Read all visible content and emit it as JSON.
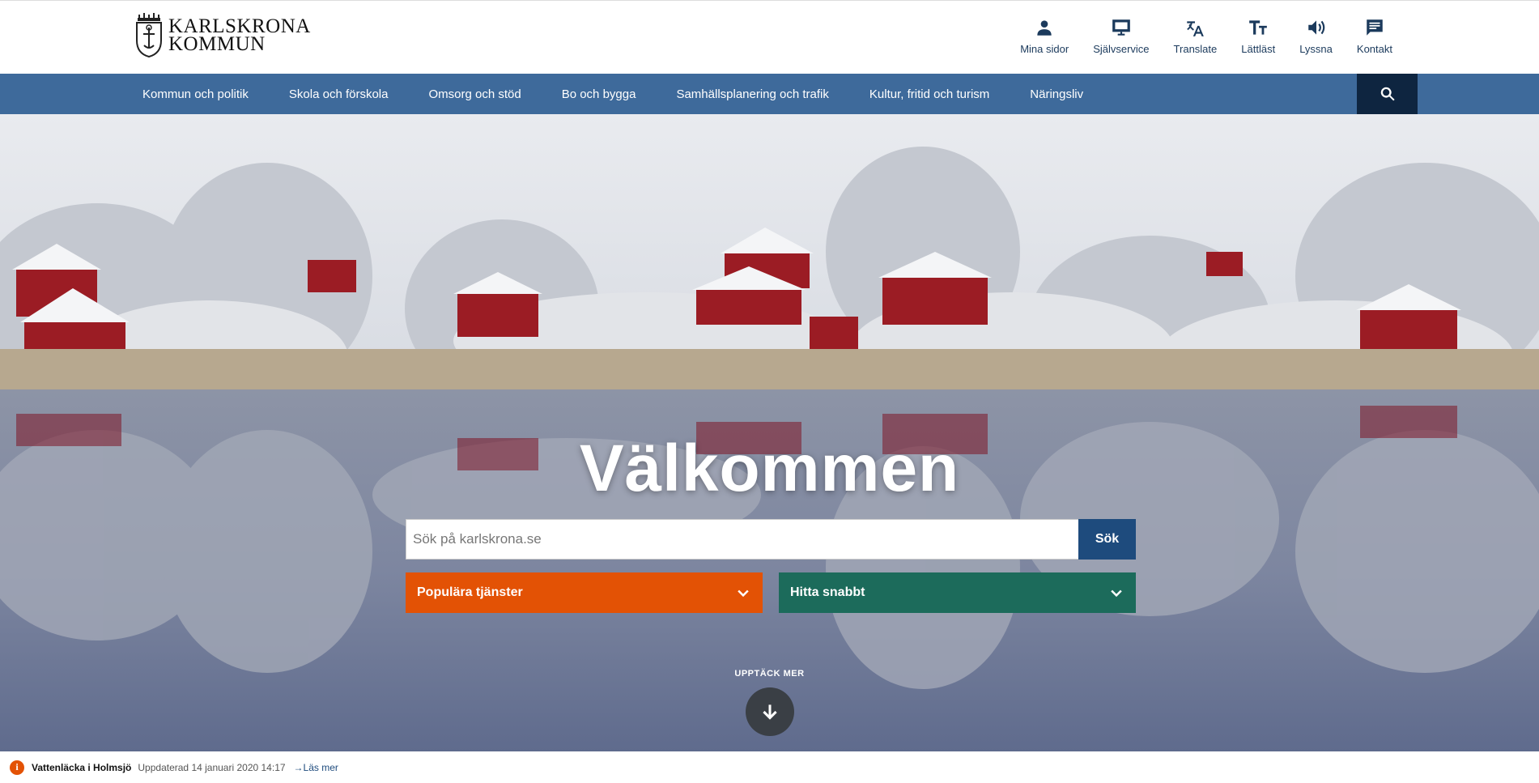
{
  "header": {
    "logo_line1": "KARLSKRONA",
    "logo_line2": "KOMMUN",
    "utility_nav": [
      {
        "label": "Mina sidor",
        "icon": "person-icon"
      },
      {
        "label": "Självservice",
        "icon": "monitor-icon"
      },
      {
        "label": "Translate",
        "icon": "translate-icon"
      },
      {
        "label": "Lättläst",
        "icon": "text-size-icon"
      },
      {
        "label": "Lyssna",
        "icon": "speaker-icon"
      },
      {
        "label": "Kontakt",
        "icon": "chat-icon"
      }
    ]
  },
  "main_nav": {
    "items": [
      "Kommun och politik",
      "Skola och förskola",
      "Omsorg och stöd",
      "Bo och bygga",
      "Samhällsplanering och trafik",
      "Kultur, fritid och turism",
      "Näringsliv"
    ],
    "search_icon": "search-icon"
  },
  "hero": {
    "title": "Välkommen",
    "search_placeholder": "Sök på karlskrona.se",
    "search_button": "Sök",
    "dropdown_popular": "Populära tjänster",
    "dropdown_quick": "Hitta snabbt",
    "discover_label": "UPPTÄCK MER"
  },
  "alert": {
    "icon": "i",
    "title": "Vattenläcka i Holmsjö",
    "updated": "Uppdaterad 14 januari 2020 14:17",
    "link": "Läs mer"
  },
  "colors": {
    "nav_blue": "#3e6a9b",
    "search_dark": "#0e2540",
    "button_blue": "#1e4b7d",
    "orange": "#e35205",
    "green": "#1c6b5b"
  }
}
